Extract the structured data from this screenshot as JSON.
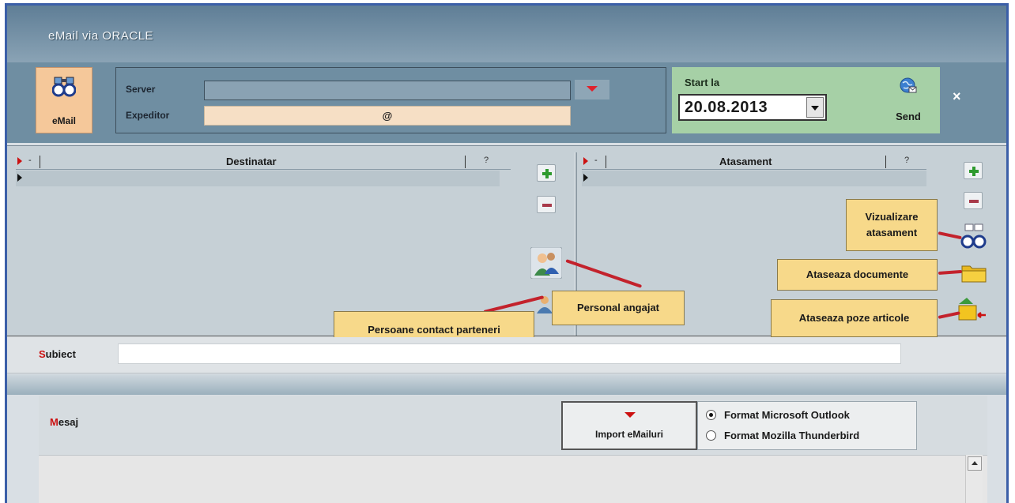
{
  "window": {
    "title": "eMail via ORACLE"
  },
  "email_button": {
    "label": "eMail",
    "icon": "binoculars-icon"
  },
  "fields": {
    "server_label": "Server",
    "server_value": "",
    "expeditor_label": "Expeditor",
    "expeditor_value": "@"
  },
  "start": {
    "label": "Start la",
    "date": "20.08.2013"
  },
  "send": {
    "label": "Send",
    "icon": "globe-send-icon"
  },
  "close": {
    "label": "×"
  },
  "grid_left": {
    "column": "Destinatar",
    "help": "?",
    "dash": "-"
  },
  "grid_right": {
    "column": "Atasament",
    "help": "?",
    "dash": "-"
  },
  "callouts": {
    "personal": "Personal angajat",
    "persoane_contact": "Persoane contact parteneri",
    "vizualizare_1": "Vizualizare",
    "vizualizare_2": "atasament",
    "ataseaza_documente": "Ataseaza documente",
    "ataseaza_poze": "Ataseaza poze articole"
  },
  "subject": {
    "label_first": "S",
    "label_rest": "ubiect",
    "value": ""
  },
  "message": {
    "label_first": "M",
    "label_rest": "esaj",
    "import_label": "Import eMailuri",
    "radio_outlook": "Format Microsoft Outlook",
    "radio_thunderbird": "Format Mozilla Thunderbird",
    "selected": "outlook"
  },
  "colors": {
    "title_bar": "#6f8ea2",
    "start_panel": "#a6d0a6",
    "callout": "#f7d98a",
    "accent_red": "#cc1111"
  }
}
